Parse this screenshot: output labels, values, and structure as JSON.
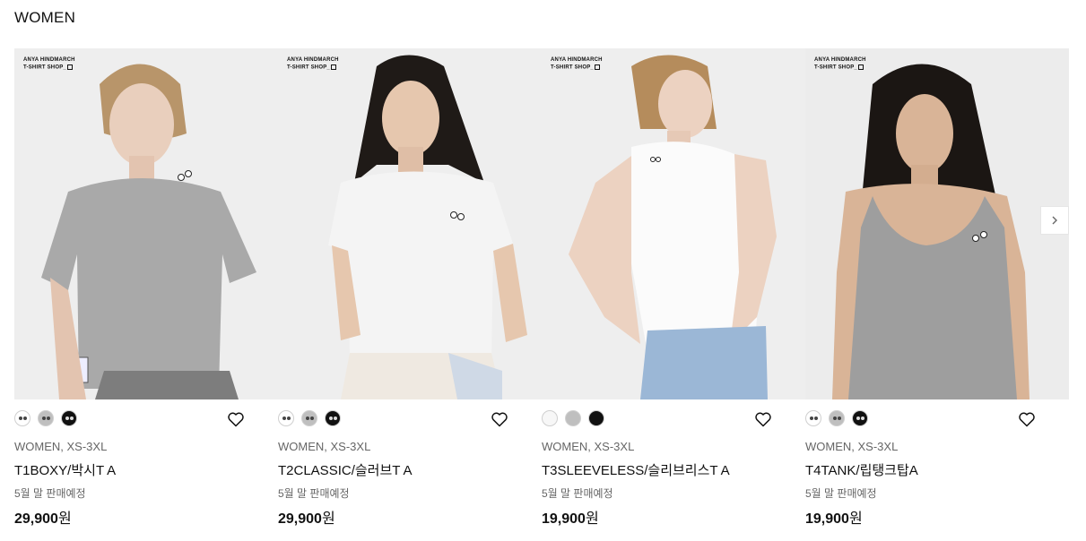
{
  "section": {
    "title": "WOMEN"
  },
  "brand_tag": {
    "line1": "ANYA HINDMARCH",
    "line2": "T-SHIRT SHOP_"
  },
  "products": [
    {
      "category": "WOMEN, XS-3XL",
      "name": "T1BOXY/박시T A",
      "status": "5월 말 판매예정",
      "price": "29,900",
      "currency": "원",
      "swatches": [
        "#ffffff",
        "#bfbfbf",
        "#111111"
      ],
      "shirt_color": "#a9a9a9",
      "bg_color": "#eeeeee"
    },
    {
      "category": "WOMEN, XS-3XL",
      "name": "T2CLASSIC/슬러브T A",
      "status": "5월 말 판매예정",
      "price": "29,900",
      "currency": "원",
      "swatches": [
        "#ffffff",
        "#bfbfbf",
        "#111111"
      ],
      "shirt_color": "#f4f4f4",
      "bg_color": "#eeeeee"
    },
    {
      "category": "WOMEN, XS-3XL",
      "name": "T3SLEEVELESS/슬리브리스T A",
      "status": "5월 말 판매예정",
      "price": "19,900",
      "currency": "원",
      "swatches": [
        "#ffffff",
        "#bfbfbf",
        "#111111"
      ],
      "shirt_color": "#fbfbfb",
      "bg_color": "#eeeeee"
    },
    {
      "category": "WOMEN, XS-3XL",
      "name": "T4TANK/립탱크탑A",
      "status": "5월 말 판매예정",
      "price": "19,900",
      "currency": "원",
      "swatches": [
        "#ffffff",
        "#bfbfbf",
        "#111111"
      ],
      "shirt_color": "#9e9e9e",
      "bg_color": "#ececec"
    }
  ],
  "icons": {
    "wishlist": "heart-outline-icon",
    "next": "chevron-right-icon"
  }
}
